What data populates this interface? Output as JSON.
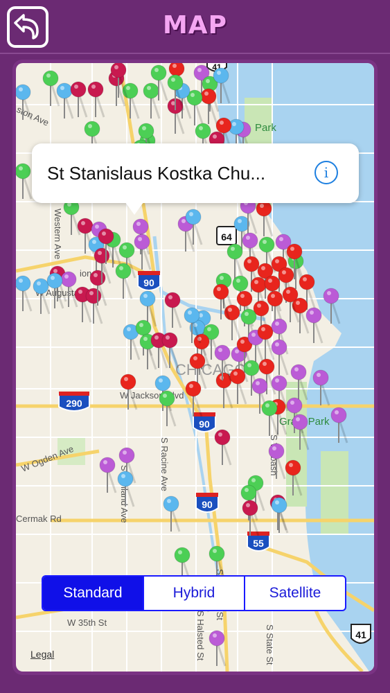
{
  "header": {
    "title": "MAP"
  },
  "callout": {
    "title": "St Stanislaus Kostka Chu..."
  },
  "segmented_control": {
    "options": [
      "Standard",
      "Hybrid",
      "Satellite"
    ],
    "selected": "Standard"
  },
  "map": {
    "legal_label": "Legal",
    "labels": {
      "lincoln_park": "Park",
      "western_ave": "Western Ave",
      "w_augusta": "W Augusta Blvd",
      "w_jackson": "W Jackson Blvd",
      "w_ogden": "W Ogden Ave",
      "cermak": "Cermak Rd",
      "w_35th": "W 35th St",
      "racine": "S Racine Ave",
      "ashland": "S Ashland Ave",
      "wallace": "S Wallace St",
      "halsted": "S Halsted St",
      "state": "S State St",
      "wabash": "S Wabash",
      "grant_park": "Grant Park",
      "ston_ave": "ston Ave",
      "ion_st": "ion St",
      "chicago": "CHICAGO"
    },
    "shields": {
      "i90_a": "90",
      "i90_b": "90",
      "i90_c": "90",
      "i290": "290",
      "i55": "55",
      "us41_top": "41",
      "us41_bottom": "41",
      "il64": "64"
    }
  },
  "colors": {
    "header_bg": "#6b2a73",
    "title": "#f4a6f2",
    "water": "#a9d3f0",
    "park": "#c9e6b5",
    "pin_red": "#e8251d",
    "pin_green": "#4ccf55",
    "pin_purple": "#bb5bd6",
    "pin_blue": "#5bb7ee",
    "pin_maroon": "#c8194f",
    "segment_active": "#1010e8"
  }
}
